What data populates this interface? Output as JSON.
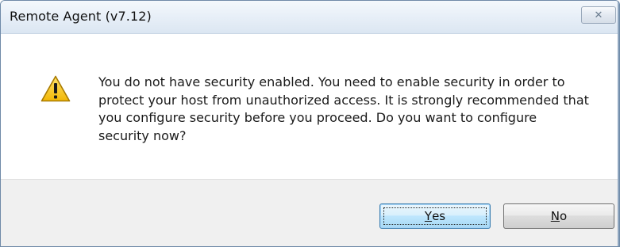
{
  "window": {
    "title": "Remote Agent (v7.12)",
    "close_glyph": "✕"
  },
  "message": {
    "icon": "warning-icon",
    "text": "You do not have security enabled. You need to enable security in order to protect your host from unauthorized access. It is strongly recommended that you configure security before you proceed. Do you want to configure security now?"
  },
  "buttons": {
    "yes": {
      "mnemonic": "Y",
      "rest": "es"
    },
    "no": {
      "mnemonic": "N",
      "rest": "o"
    }
  },
  "colors": {
    "warning_fill": "#f5c518",
    "warning_border": "#a87a00",
    "titlebar": "#e6eef7",
    "footer": "#f0f0f0"
  }
}
